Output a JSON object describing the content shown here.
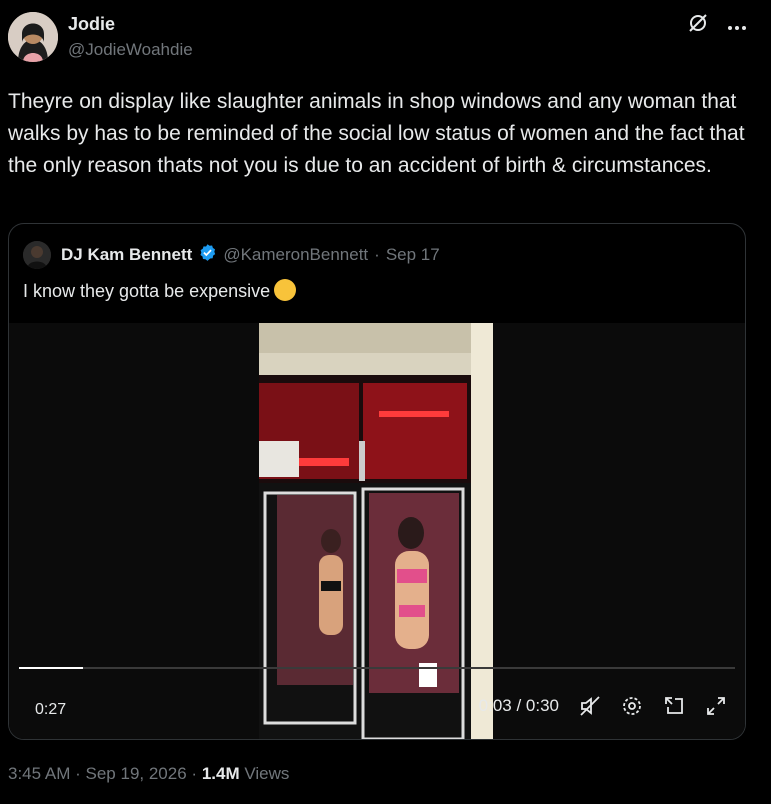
{
  "author": {
    "name": "Jodie",
    "handle": "@JodieWoahdie"
  },
  "icons": {
    "grok": "grok-icon",
    "more": "more-icon"
  },
  "tweet": {
    "text": "Theyre on display like slaughter animals in shop windows and any woman that walks by has to be reminded of the social low status of women and the fact that the only reason thats not you is due to an accident of birth & circumstances."
  },
  "quote": {
    "name": "DJ Kam Bennett",
    "handle": "@KameronBennett",
    "separator": "·",
    "date": "Sep 17",
    "text": "I know they gotta be expensive",
    "emoji": "relieved-face-emoji"
  },
  "video": {
    "elapsed_label": "0:27",
    "time_display": "0:03 / 0:30",
    "progress_fraction": 0.09,
    "icons": [
      "mute-icon",
      "settings-icon",
      "pip-icon",
      "fullscreen-icon"
    ]
  },
  "meta": {
    "time": "3:45 AM",
    "sep": "·",
    "date": "Sep 19, 2026",
    "views_count": "1.4M",
    "views_label": "Views"
  },
  "colors": {
    "background": "#000000",
    "text": "#e7e9ea",
    "muted": "#71767b",
    "verified": "#1d9bf0"
  }
}
